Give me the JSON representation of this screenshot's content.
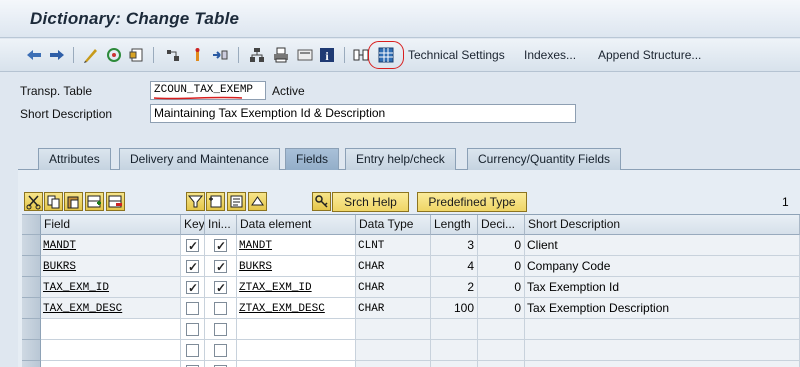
{
  "window": {
    "title": "Dictionary: Change Table"
  },
  "toolbar": {
    "technical_settings": "Technical Settings",
    "indexes": "Indexes...",
    "append_structure": "Append Structure..."
  },
  "header": {
    "table_label": "Transp. Table",
    "table_name": "ZCOUN_TAX_EXEMP",
    "status": "Active",
    "short_desc_label": "Short Description",
    "short_desc_value": "Maintaining Tax Exemption Id & Description"
  },
  "tabs": [
    {
      "label": "Attributes",
      "active": false
    },
    {
      "label": "Delivery and Maintenance",
      "active": false
    },
    {
      "label": "Fields",
      "active": true
    },
    {
      "label": "Entry help/check",
      "active": false
    },
    {
      "label": "Currency/Quantity Fields",
      "active": false
    }
  ],
  "fields_toolbar": {
    "srch_help": "Srch Help",
    "predefined_type": "Predefined Type",
    "page_indicator": "1"
  },
  "grid": {
    "columns": [
      "Field",
      "Key",
      "Ini...",
      "Data element",
      "Data Type",
      "Length",
      "Deci...",
      "Short Description"
    ],
    "rows": [
      {
        "field": "MANDT",
        "key": true,
        "initial": true,
        "data_element": "MANDT",
        "data_type": "CLNT",
        "length": "3",
        "decimals": "0",
        "description": "Client"
      },
      {
        "field": "BUKRS",
        "key": true,
        "initial": true,
        "data_element": "BUKRS",
        "data_type": "CHAR",
        "length": "4",
        "decimals": "0",
        "description": "Company Code"
      },
      {
        "field": "TAX_EXM_ID",
        "key": true,
        "initial": true,
        "data_element": "ZTAX_EXM_ID",
        "data_type": "CHAR",
        "length": "2",
        "decimals": "0",
        "description": "Tax Exemption Id"
      },
      {
        "field": "TAX_EXM_DESC",
        "key": false,
        "initial": false,
        "data_element": "ZTAX_EXM_DESC",
        "data_type": "CHAR",
        "length": "100",
        "decimals": "0",
        "description": "Tax Exemption Description"
      }
    ],
    "empty_rows": 3
  },
  "colors": {
    "annotation_red": "#d81e1e",
    "yellow_button": "#efd566"
  }
}
